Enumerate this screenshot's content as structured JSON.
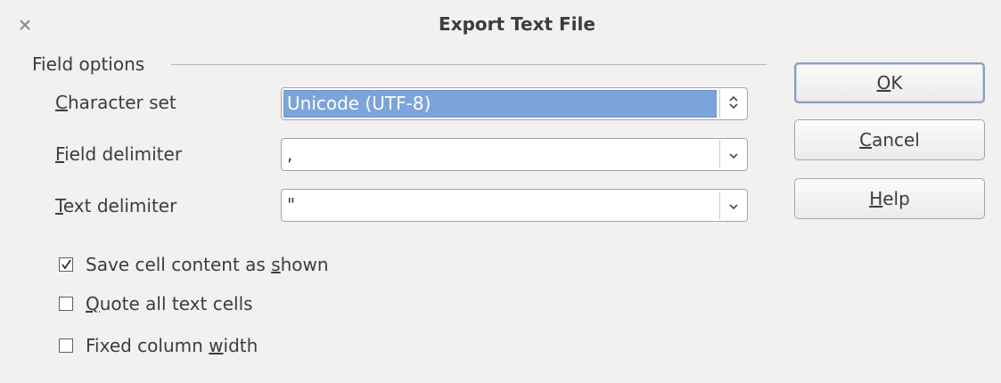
{
  "dialog": {
    "title": "Export Text File",
    "close_icon": "close-icon"
  },
  "field_options": {
    "header": "Field options",
    "character_set": {
      "label_mnemonic": "C",
      "label_rest": "haracter set",
      "value": "Unicode (UTF-8)",
      "arrow_icon": "spin-up-down-icon"
    },
    "field_delimiter": {
      "label_mnemonic": "F",
      "label_rest": "ield delimiter",
      "value": ",",
      "arrow_icon": "chevron-down-icon"
    },
    "text_delimiter": {
      "label_mnemonic": "T",
      "label_rest": "ext delimiter",
      "value": "\"",
      "arrow_icon": "chevron-down-icon"
    }
  },
  "options": {
    "save_as_shown": {
      "pre": "Save cell content as ",
      "mnemonic": "s",
      "post": "hown",
      "checked": true
    },
    "quote_all": {
      "pre": "",
      "mnemonic": "Q",
      "post": "uote all text cells",
      "checked": false
    },
    "fixed_width": {
      "pre": "Fixed column ",
      "mnemonic": "w",
      "post": "idth",
      "checked": false
    }
  },
  "buttons": {
    "ok": {
      "mnemonic": "O",
      "rest": "K"
    },
    "cancel": {
      "mnemonic": "C",
      "rest": "ancel"
    },
    "help": {
      "mnemonic": "H",
      "rest": "elp"
    }
  },
  "colors": {
    "background": "#f2f1f0",
    "selection": "#7da4d9",
    "text": "#3c3c3c"
  }
}
